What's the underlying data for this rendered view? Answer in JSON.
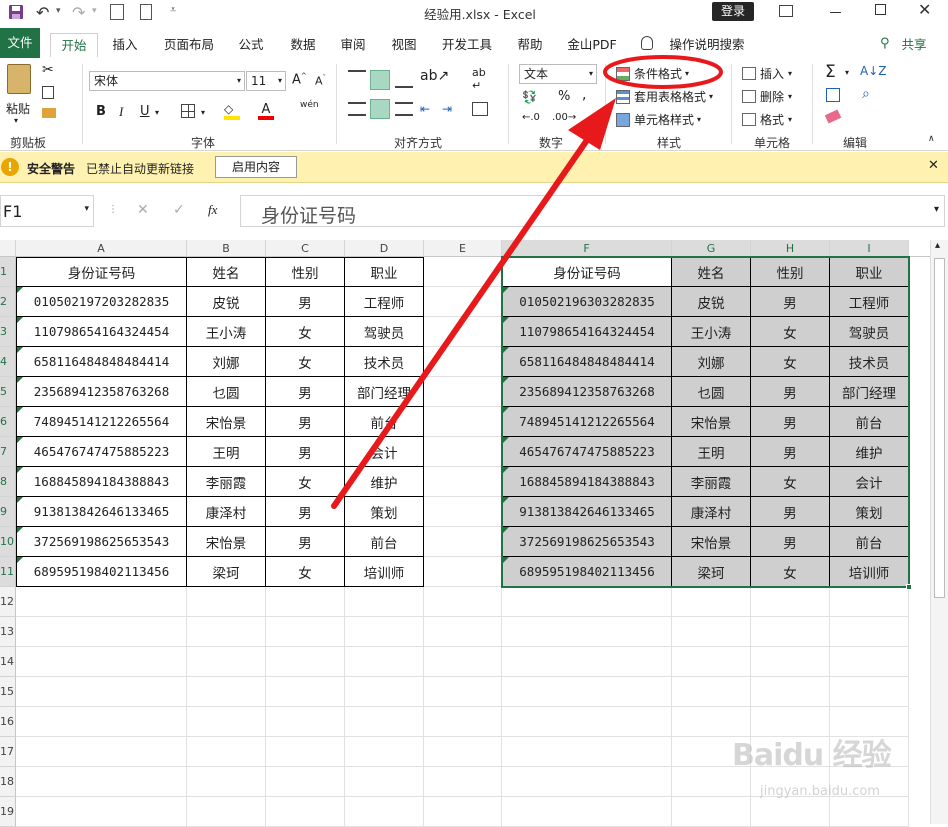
{
  "titlebar": {
    "title": "经验用.xlsx  -  Excel",
    "login_label": "登录"
  },
  "tabs": [
    {
      "label": "文件"
    },
    {
      "label": "开始"
    },
    {
      "label": "插入"
    },
    {
      "label": "页面布局"
    },
    {
      "label": "公式"
    },
    {
      "label": "数据"
    },
    {
      "label": "审阅"
    },
    {
      "label": "视图"
    },
    {
      "label": "开发工具"
    },
    {
      "label": "帮助"
    },
    {
      "label": "金山PDF"
    },
    {
      "label": "操作说明搜索"
    }
  ],
  "share_label": "共享",
  "ribbon": {
    "clipboard": {
      "label": "剪贴板",
      "paste": "粘贴"
    },
    "font": {
      "label": "字体",
      "name": "宋体",
      "size": "11",
      "bold": "B",
      "italic": "I",
      "underline": "U",
      "pinyin": "wén"
    },
    "alignment": {
      "label": "对齐方式"
    },
    "number": {
      "label": "数字",
      "format": "文本"
    },
    "styles": {
      "label": "样式",
      "conditional": "条件格式",
      "table": "套用表格格式",
      "cell": "单元格样式"
    },
    "cells": {
      "label": "单元格",
      "insert": "插入",
      "delete": "删除",
      "format": "格式"
    },
    "editing": {
      "label": "编辑"
    }
  },
  "security_bar": {
    "title": "安全警告",
    "message": "已禁止自动更新链接",
    "button": "启用内容"
  },
  "formula_bar": {
    "name_box": "F1",
    "fx": "fx",
    "content": "身份证号码"
  },
  "columns": [
    "A",
    "B",
    "C",
    "D",
    "E",
    "F",
    "G",
    "H",
    "I"
  ],
  "rows": [
    "1",
    "2",
    "3",
    "4",
    "5",
    "6",
    "7",
    "8",
    "9",
    "10",
    "11",
    "12",
    "13",
    "14",
    "15",
    "16",
    "17",
    "18",
    "19"
  ],
  "table_left": {
    "headers": [
      "身份证号码",
      "姓名",
      "性别",
      "职业"
    ],
    "rows": [
      [
        "010502197203282835",
        "皮锐",
        "男",
        "工程师"
      ],
      [
        "110798654164324454",
        "王小涛",
        "女",
        "驾驶员"
      ],
      [
        "658116484848484414",
        "刘娜",
        "女",
        "技术员"
      ],
      [
        "235689412358763268",
        "乜圆",
        "男",
        "部门经理"
      ],
      [
        "748945141212265564",
        "宋怡景",
        "男",
        "前台"
      ],
      [
        "465476747475885223",
        "王明",
        "男",
        "会计"
      ],
      [
        "168845894184388843",
        "李丽霞",
        "女",
        "维护"
      ],
      [
        "913813842646133465",
        "康泽村",
        "男",
        "策划"
      ],
      [
        "372569198625653543",
        "宋怡景",
        "男",
        "前台"
      ],
      [
        "689595198402113456",
        "梁珂",
        "女",
        "培训师"
      ]
    ]
  },
  "table_right": {
    "headers": [
      "身份证号码",
      "姓名",
      "性别",
      "职业"
    ],
    "rows": [
      [
        "010502196303282835",
        "皮锐",
        "男",
        "工程师"
      ],
      [
        "110798654164324454",
        "王小涛",
        "女",
        "驾驶员"
      ],
      [
        "658116484848484414",
        "刘娜",
        "女",
        "技术员"
      ],
      [
        "235689412358763268",
        "乜圆",
        "男",
        "部门经理"
      ],
      [
        "748945141212265564",
        "宋怡景",
        "男",
        "前台"
      ],
      [
        "465476747475885223",
        "王明",
        "男",
        "维护"
      ],
      [
        "168845894184388843",
        "李丽霞",
        "女",
        "会计"
      ],
      [
        "913813842646133465",
        "康泽村",
        "男",
        "策划"
      ],
      [
        "372569198625653543",
        "宋怡景",
        "男",
        "前台"
      ],
      [
        "689595198402113456",
        "梁珂",
        "女",
        "培训师"
      ]
    ]
  },
  "colors": {
    "excel_green": "#217346",
    "highlight_gray": "#cfcfcf",
    "security_bg": "#fff2b0",
    "annotation_red": "#e8191b"
  }
}
